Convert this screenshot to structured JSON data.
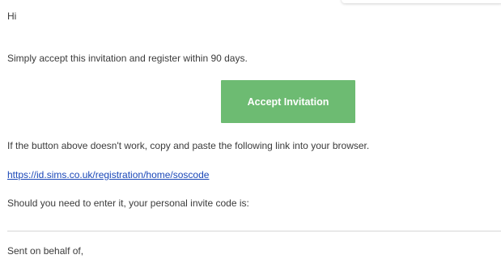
{
  "email": {
    "greeting": "Hi",
    "intro": "Simply accept this invitation and register within 90 days.",
    "accept_button": "Accept Invitation",
    "fallback_text": "If the button above doesn't work, copy and paste the following link into your browser.",
    "registration_link": "https://id.sims.co.uk/registration/home/soscode",
    "invite_code_text": "Should you need to enter it, your personal invite code is:",
    "sign_off": "Sent on behalf of,"
  },
  "colors": {
    "accept_button_bg": "#6dbb72",
    "link": "#1a47b8",
    "text": "#3b3b3b"
  }
}
